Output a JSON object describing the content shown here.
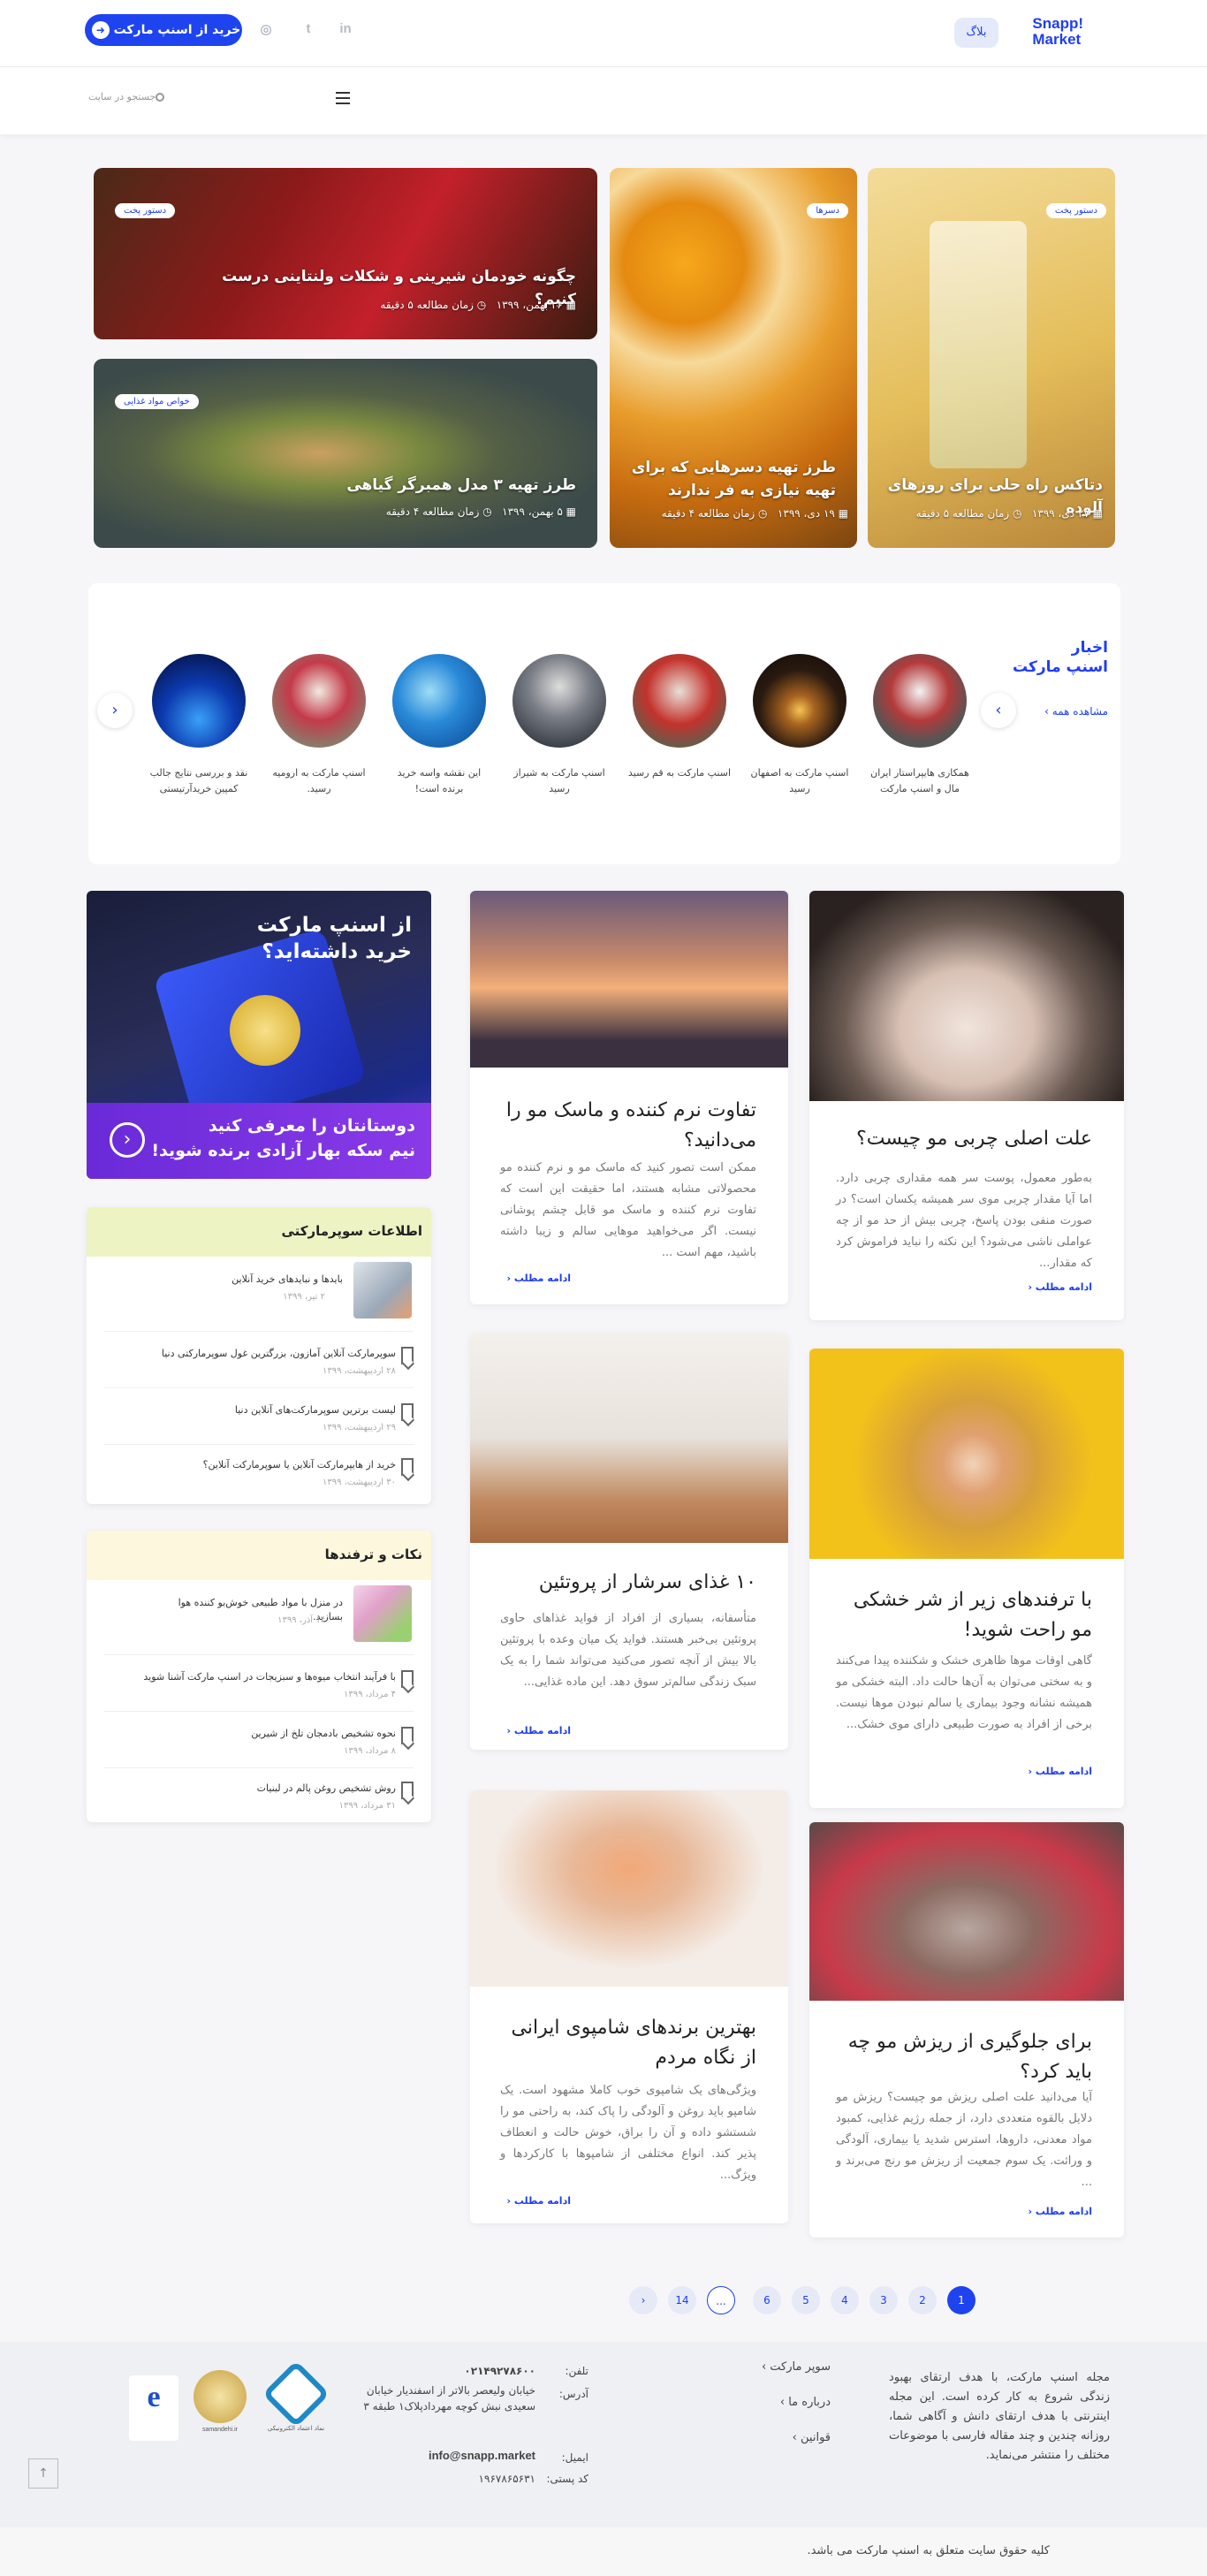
{
  "header": {
    "logo_line1": "Snapp!",
    "logo_line2": "Market",
    "blog": "بلاگ",
    "buy": "خرید از اسنپ مارکت",
    "social": {
      "linkedin": "in",
      "twitter": "t",
      "instagram": "◎"
    }
  },
  "nav": {
    "search_placeholder": "جستجو در سایت"
  },
  "hero": [
    {
      "tag": "دستور پخت",
      "title": "دتاکس راه حلی برای روزهای آلوده",
      "date": "۲۷ دی، ۱۳۹۹",
      "read": "زمان مطالعه ۵ دقیقه"
    },
    {
      "tag": "دسرها",
      "title": "طرز تهیه دسرهایی که برای تهیه نیازی به فر ندارند",
      "date": "۱۹ دی، ۱۳۹۹",
      "read": "زمان مطالعه ۴ دقیقه"
    },
    {
      "tag": "دستور پخت",
      "title": "چگونه خودمان شیرینی و شکلات ولنتاینی درست کنیم؟",
      "date": "۲۶ بهمن، ۱۳۹۹",
      "read": "زمان مطالعه ۵ دقیقه"
    },
    {
      "tag": "خواص مواد غذایی",
      "title": "طرز تهیه ۳ مدل همبرگر گیاهی",
      "date": "۵ بهمن، ۱۳۹۹",
      "read": "زمان مطالعه ۴ دقیقه"
    }
  ],
  "news": {
    "title_line1": "اخبار",
    "title_line2": "اسنپ مارکت",
    "see_all": "مشاهده همه",
    "items": [
      "همکاری هایپراستار ایران مال و اسنپ مارکت",
      "اسنپ مارکت به اصفهان رسید",
      "اسنپ مارکت به قم رسید",
      "اسنپ مارکت به شیراز رسید",
      "این نقشه واسه خرید برنده است!",
      "اسنپ مارکت به ارومیه رسید.",
      "نقد و بررسی نتایج جالب کمپین خریدآرتیستی"
    ]
  },
  "articles": [
    {
      "title": "علت اصلی چربی مو چیست؟",
      "text": "به‌طور معمول، پوست سر همه مقداری چربی دارد. اما آیا مقدار چربی موی سر همیشه یکسان است؟ در صورت منفی بودن پاسخ، چربی بیش از حد مو از چه عواملی ناشی می‌شود؟ این نکته را نباید فراموش کرد که مقدار..."
    },
    {
      "title": "تفاوت نرم کننده و ماسک مو را می‌دانید؟",
      "text": "ممکن است تصور کنید که ماسک مو و نرم کننده مو محصولاتی مشابه هستند، اما حقیقت این است که تفاوت نرم کننده و ماسک مو قابل چشم پوشانی نیست. اگر می‌خواهید موهایی سالم و زیبا داشته باشید، مهم است ..."
    },
    {
      "title": "با ترفندهای زیر از شر خشکی مو راحت شوید!",
      "text": "گاهی اوقات موها ظاهری خشک و شکننده پیدا می‌کنند و به سختی می‌توان به آن‌ها حالت داد. البته خشکی مو همیشه نشانه وجود بیماری یا سالم نبودن موها نیست. برخی از افراد به صورت طبیعی دارای موی خشک..."
    },
    {
      "title": "۱۰ غذای سرشار از پروتئین",
      "text": "متأسفانه، بسیاری از افراد از فواید غذاهای حاوی پروتئین بی‌خبر هستند. فواید یک میان وعده با پروتئین بالا بیش از آنچه تصور می‌کنید می‌تواند شما را به یک سبک زندگی سالم‌تر سوق دهد. این ماده غذایی..."
    },
    {
      "title": "برای جلوگیری از ریزش مو چه باید کرد؟",
      "text": "آیا می‌دانید علت اصلی ریزش مو چیست؟ ریزش مو دلایل بالقوه متعددی دارد، از جمله رژیم غذایی، کمبود مواد معدنی، داروها، استرس شدید یا بیماری، آلودگی و وراثت. یک سوم جمعیت از ریزش مو رنج می‌برند و ..."
    },
    {
      "title": "بهترین برندهای شامپوی ایرانی از نگاه مردم",
      "text": "ویژگی‌های یک شامپوی خوب کاملا مشهود است. یک شامپو باید روغن و آلودگی را پاک کند، به راحتی مو را شستشو داده و آن را براق، خوش حالت و انعطاف پذیر کند. انواع مختلفی از شامپوها با کارکردها و ویژگ..."
    }
  ],
  "more": "ادامه مطلب",
  "promo": {
    "line1": "از اسنپ مارکت",
    "line2": "خرید داشته‌اید؟",
    "line3": "دوستانتان را معرفی کنید",
    "line4": "نیم سکه بهار آزادی برنده شوید!"
  },
  "widget1": {
    "title": "اطلاعات سوپرمارکتی",
    "items": [
      {
        "text": "بایدها و نبایدهای خرید آنلاین",
        "date": "۲ تیر، ۱۳۹۹"
      },
      {
        "text": "سوپرمارکت آنلاین آمازون، بزرگترین غول سوپرمارکتی دنیا",
        "date": "۲۸ اردیبهشت، ۱۳۹۹"
      },
      {
        "text": "لیست برترین سوپرمارکت‌های آنلاین دنیا",
        "date": "۲۹ اردیبهشت، ۱۳۹۹"
      },
      {
        "text": "خرید از هایپرمارکت آنلاین یا سوپرمارکت آنلاین؟",
        "date": "۳۰ اردیبهشت، ۱۳۹۹"
      }
    ]
  },
  "widget2": {
    "title": "نکات و ترفندها",
    "items": [
      {
        "text": "در منزل با مواد طبیعی خوش‌بو کننده هوا بسازید.",
        "date": "۱۴ آذر، ۱۳۹۹"
      },
      {
        "text": "با فرآیند انتخاب میوه‌ها و سبزیجات در اسنپ مارکت آشنا شوید",
        "date": "۴ مرداد، ۱۳۹۹"
      },
      {
        "text": "نحوه تشخیص بادمجان تلخ از شیرین",
        "date": "۸ مرداد، ۱۳۹۹"
      },
      {
        "text": "روش تشخیص روغن پالم در لبنیات",
        "date": "۳۱ مرداد، ۱۳۹۹"
      }
    ]
  },
  "pagination": [
    "1",
    "2",
    "3",
    "4",
    "5",
    "6",
    "...",
    "14"
  ],
  "footer": {
    "about": "مجله اسنپ مارکت، با هدف ارتقای بهبود زندگی شروع به کار کرده است. این مجله اینترنتی با هدف ارتقای دانش و آگاهی شما، روزانه چندین و چند مقاله فارسی با موضوعات مختلف را منتشر می‌نماید.",
    "links": [
      "سوپر مارکت",
      "درباره ما",
      "قوانین"
    ],
    "phone_label": "تلفن:",
    "phone": "۰۲۱۴۹۲۷۸۶۰۰",
    "address_label": "آدرس:",
    "address": "خیابان ولیعصر بالاتر از اسفندیار خیابان سعیدی نبش کوچه مهردادپلاک۱ طبقه ۳",
    "email_label": "ایمیل:",
    "email": "info@snapp.market",
    "postal_label": "کد پستی:",
    "postal": "۱۹۶۷۸۶۵۶۳۱",
    "badge1": "نماد اعتماد الکترونیکی",
    "badge2": "samandehi.ir",
    "badge3": "e",
    "copyright": "کلیه حقوق سایت متعلق به اسنپ مارکت می باشد."
  },
  "colors": {
    "brand": "#1e3df5",
    "widget_header1": "#eef3c4",
    "widget_header2": "#fcf7dd"
  }
}
